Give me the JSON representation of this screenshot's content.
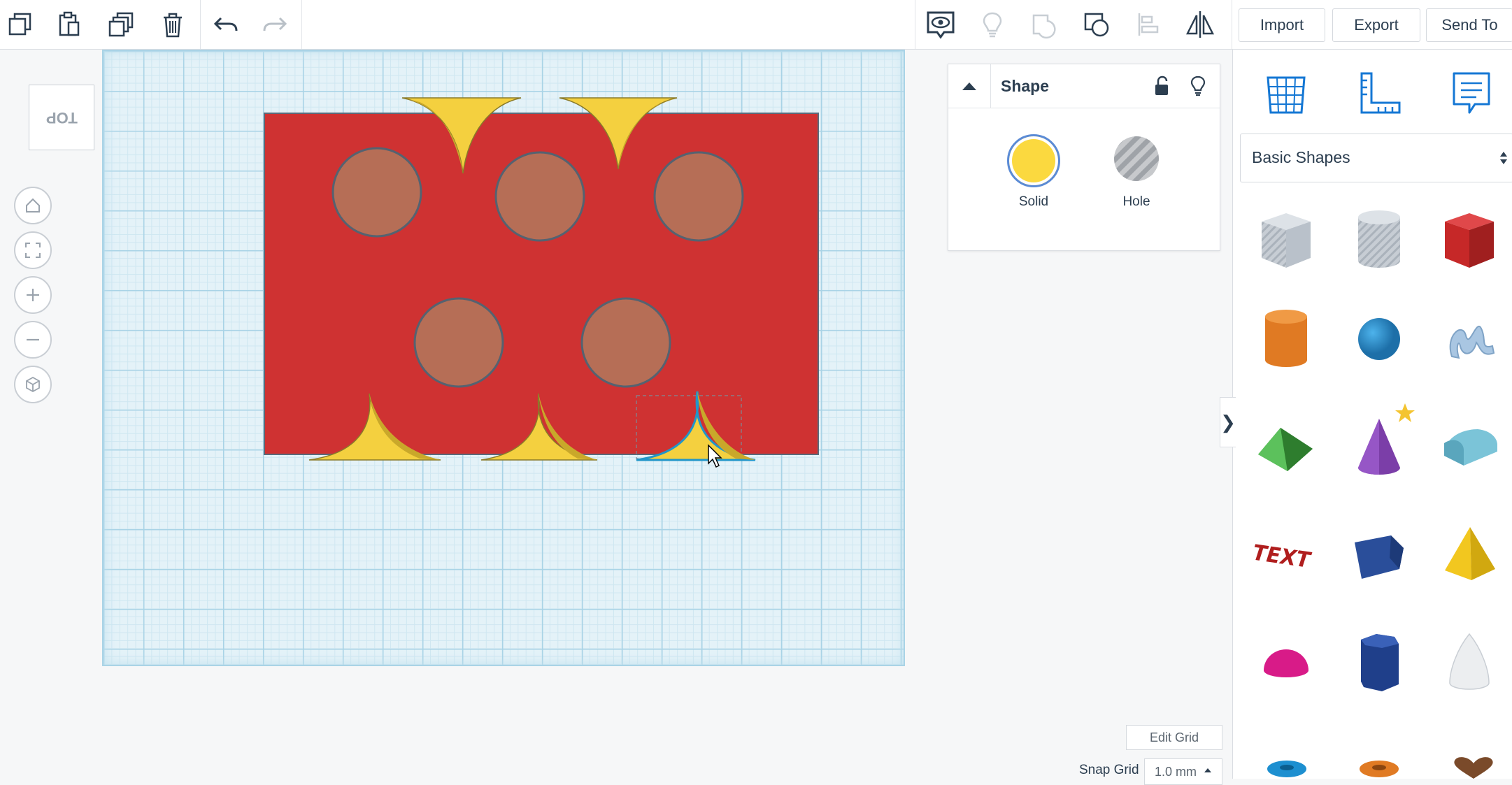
{
  "toolbar": {
    "import_label": "Import",
    "export_label": "Export",
    "send_to_label": "Send To"
  },
  "viewcube": {
    "face_label": "TOP"
  },
  "inspector": {
    "title": "Shape",
    "solid_label": "Solid",
    "hole_label": "Hole",
    "solid_color": "#fbd93f"
  },
  "library": {
    "selected_category": "Basic Shapes"
  },
  "grid": {
    "edit_grid_label": "Edit Grid",
    "snap_grid_label": "Snap Grid",
    "snap_grid_value": "1.0 mm"
  },
  "colors": {
    "accent": "#1477d4",
    "base_red": "#cf3232",
    "cylinder_hole": "#b66e56",
    "yellow_shape": "#f4d03f"
  }
}
